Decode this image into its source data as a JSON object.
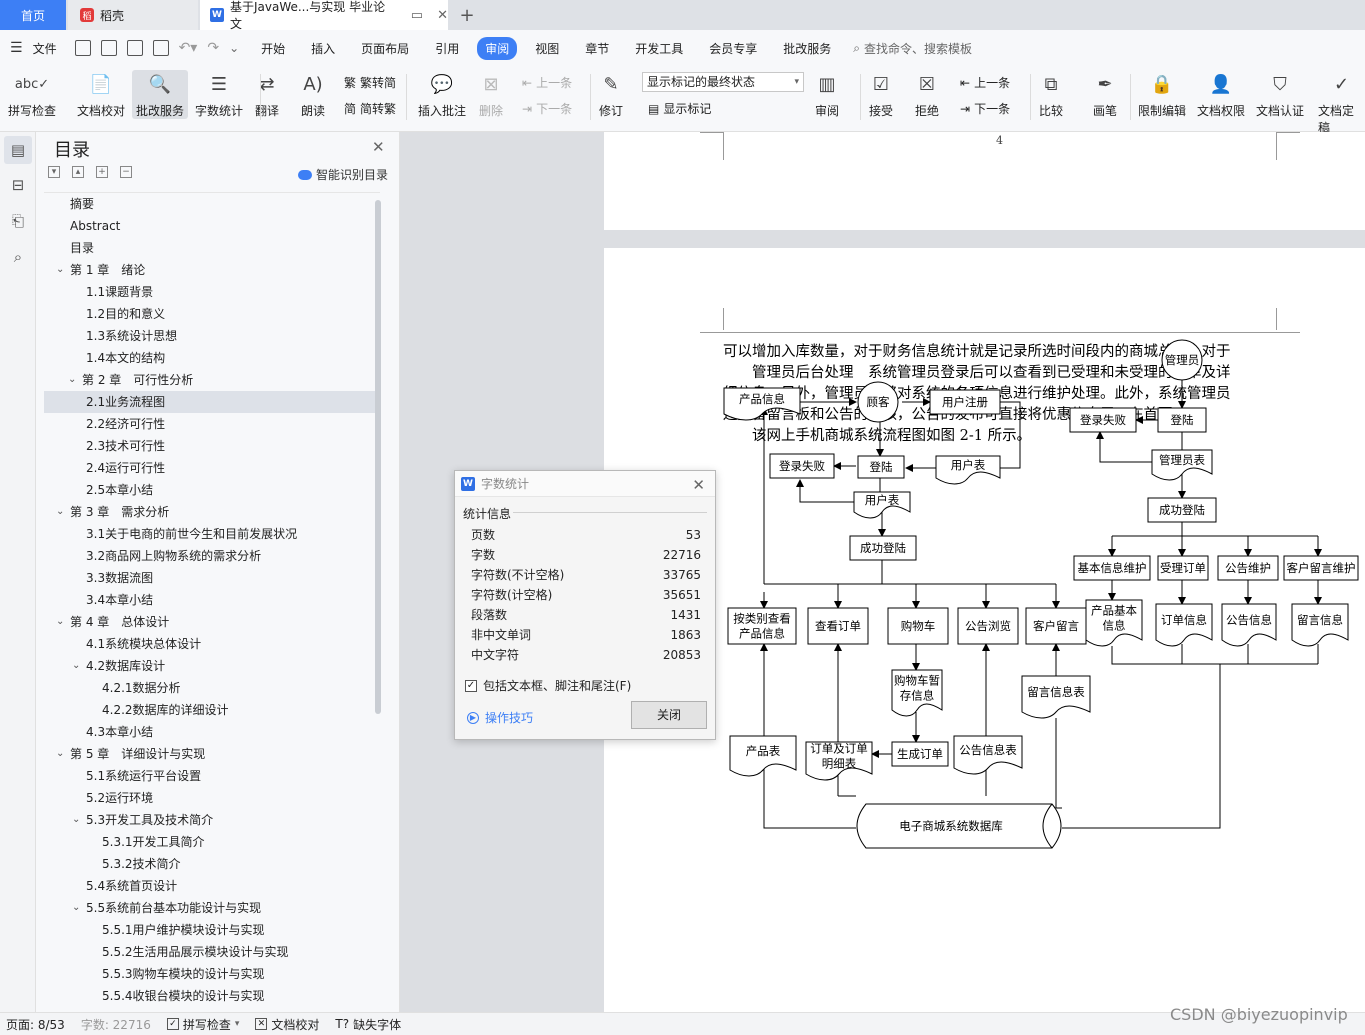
{
  "tabs": {
    "home": "首页",
    "daoke": "稻壳",
    "doc_title": "基于JavaWe...与实现 毕业论文"
  },
  "menubar": {
    "file": "文件",
    "items": [
      "开始",
      "插入",
      "页面布局",
      "引用",
      "审阅",
      "视图",
      "章节",
      "开发工具",
      "会员专享",
      "批改服务"
    ],
    "active": "审阅",
    "search": "查找命令、搜索模板"
  },
  "ribbon": {
    "spell_check": "拼写检查",
    "doc_proof": "文档校对",
    "review_service": "批改服务",
    "word_count": "字数统计",
    "translate": "翻译",
    "read_aloud": "朗读",
    "trad_simp": "繁转简",
    "simp_trad": "简转繁",
    "insert_comment": "插入批注",
    "delete": "删除",
    "prev1": "上一条",
    "next1": "下一条",
    "track_changes": "修订",
    "markup_select": "显示标记的最终状态",
    "show_markup": "显示标记",
    "review": "审阅",
    "accept": "接受",
    "reject": "拒绝",
    "prev2": "上一条",
    "next2": "下一条",
    "compare": "比较",
    "pen": "画笔",
    "restrict_edit": "限制编辑",
    "doc_permission": "文档权限",
    "doc_certify": "文档认证",
    "doc_finalize": "文档定稿"
  },
  "toc": {
    "title": "目录",
    "smart": "智能识别目录",
    "items": [
      {
        "label": "摘要",
        "level": 0,
        "caret": false
      },
      {
        "label": "Abstract",
        "level": 0,
        "caret": false
      },
      {
        "label": "目录",
        "level": 0,
        "caret": false
      },
      {
        "label": "第 1 章　绪论",
        "level": 0,
        "caret": true
      },
      {
        "label": "1.1课题背景",
        "level": 1,
        "caret": false
      },
      {
        "label": "1.2目的和意义",
        "level": 1,
        "caret": false
      },
      {
        "label": "1.3系统设计思想",
        "level": 1,
        "caret": false
      },
      {
        "label": "1.4本文的结构",
        "level": 1,
        "caret": false
      },
      {
        "label": "第 2 章　可行性分析",
        "level": 0.5,
        "caret": true
      },
      {
        "label": "2.1业务流程图",
        "level": 1,
        "caret": false,
        "selected": true
      },
      {
        "label": "2.2经济可行性",
        "level": 1,
        "caret": false
      },
      {
        "label": "2.3技术可行性",
        "level": 1,
        "caret": false
      },
      {
        "label": "2.4运行可行性",
        "level": 1,
        "caret": false
      },
      {
        "label": "2.5本章小结",
        "level": 1,
        "caret": false
      },
      {
        "label": "第 3 章　需求分析",
        "level": 0,
        "caret": true
      },
      {
        "label": "3.1关于电商的前世今生和目前发展状况",
        "level": 1,
        "caret": false
      },
      {
        "label": "3.2商品网上购物系统的需求分析",
        "level": 1,
        "caret": false
      },
      {
        "label": "3.3数据流图",
        "level": 1,
        "caret": false
      },
      {
        "label": "3.4本章小结",
        "level": 1,
        "caret": false
      },
      {
        "label": "第 4 章　总体设计",
        "level": 0,
        "caret": true
      },
      {
        "label": "4.1系统模块总体设计",
        "level": 1,
        "caret": false
      },
      {
        "label": "4.2数据库设计",
        "level": 1,
        "caret": true
      },
      {
        "label": "4.2.1数据分析",
        "level": 2,
        "caret": false
      },
      {
        "label": "4.2.2数据库的详细设计",
        "level": 2,
        "caret": false
      },
      {
        "label": "4.3本章小结",
        "level": 1,
        "caret": false
      },
      {
        "label": "第 5 章　详细设计与实现",
        "level": 0,
        "caret": true
      },
      {
        "label": "5.1系统运行平台设置",
        "level": 1,
        "caret": false
      },
      {
        "label": "5.2运行环境",
        "level": 1,
        "caret": false
      },
      {
        "label": "5.3开发工具及技术简介",
        "level": 1,
        "caret": true
      },
      {
        "label": "5.3.1开发工具简介",
        "level": 2,
        "caret": false
      },
      {
        "label": "5.3.2技术简介",
        "level": 2,
        "caret": false
      },
      {
        "label": "5.4系统首页设计",
        "level": 1,
        "caret": false
      },
      {
        "label": "5.5系统前台基本功能设计与实现",
        "level": 1,
        "caret": true
      },
      {
        "label": "5.5.1用户维护模块设计与实现",
        "level": 2,
        "caret": false
      },
      {
        "label": "5.5.2生活用品展示模块设计与实现",
        "level": 2,
        "caret": false
      },
      {
        "label": "5.5.3购物车模块的设计与实现",
        "level": 2,
        "caret": false
      },
      {
        "label": "5.5.4收银台模块的设计与实现",
        "level": 2,
        "caret": false
      }
    ]
  },
  "document": {
    "page_number": "4",
    "paragraph_lines": [
      "可以增加入库数量，对于财务信息统计就是记录所选时间段内的商城总额。对于",
      "　　管理员后台处理　系统管理员登录后可以查看到已受理和未受理的订单及详",
      "细信息。另外，管理员能够对系统的各项信息进行维护处理。此外，系统管理员",
      "还具备留言板和公告的审核，公告的发布可直接将优惠信息展示在首页。",
      "　　该网上手机商城系统流程图如图 2-1 所示。"
    ],
    "flowchart": {
      "product_info": "产品信息",
      "customer": "顾客",
      "user_register": "用户注册",
      "login_fail_1": "登录失败",
      "login_1": "登陆",
      "user_table_1": "用户表",
      "user_table_2": "用户表",
      "login_success_1": "成功登陆",
      "browse_by_category": [
        "按类别查看",
        "产品信息"
      ],
      "view_orders": "查看订单",
      "cart": "购物车",
      "announce_browse": "公告浏览",
      "customer_message": "客户留言",
      "cart_temp": [
        "购物车暂",
        "存信息"
      ],
      "message_table": "留言信息表",
      "product_table": "产品表",
      "order_tables": [
        "订单及订单",
        "明细表"
      ],
      "gen_order": "生成订单",
      "announce_table": "公告信息表",
      "database": "电子商城系统数据库",
      "admin": "管理员",
      "login_fail_2": "登录失败",
      "login_2": "登陆",
      "admin_table": "管理员表",
      "login_success_2": "成功登陆",
      "basic_maint": "基本信息维护",
      "accept_order": "受理订单",
      "announce_maint": "公告维护",
      "message_maint": "客户留言维护",
      "product_basic": [
        "产品基本",
        "信息"
      ],
      "order_info": "订单信息",
      "announce_info": "公告信息",
      "message_info": "留言信息"
    }
  },
  "dialog": {
    "title": "字数统计",
    "section": "统计信息",
    "rows": [
      {
        "label": "页数",
        "value": "53"
      },
      {
        "label": "字数",
        "value": "22716"
      },
      {
        "label": "字符数(不计空格)",
        "value": "33765"
      },
      {
        "label": "字符数(计空格)",
        "value": "35651"
      },
      {
        "label": "段落数",
        "value": "1431"
      },
      {
        "label": "非中文单词",
        "value": "1863"
      },
      {
        "label": "中文字符",
        "value": "20853"
      }
    ],
    "include_checkbox": "包括文本框、脚注和尾注(F)",
    "include_checked": true,
    "tips": "操作技巧",
    "close": "关闭"
  },
  "status": {
    "page": "页面: 8/53",
    "words": "字数: 22716",
    "spell": "拼写检查",
    "proof": "文档校对",
    "missing_font": "缺失字体"
  },
  "watermark": "CSDN @biyezuopinvip"
}
